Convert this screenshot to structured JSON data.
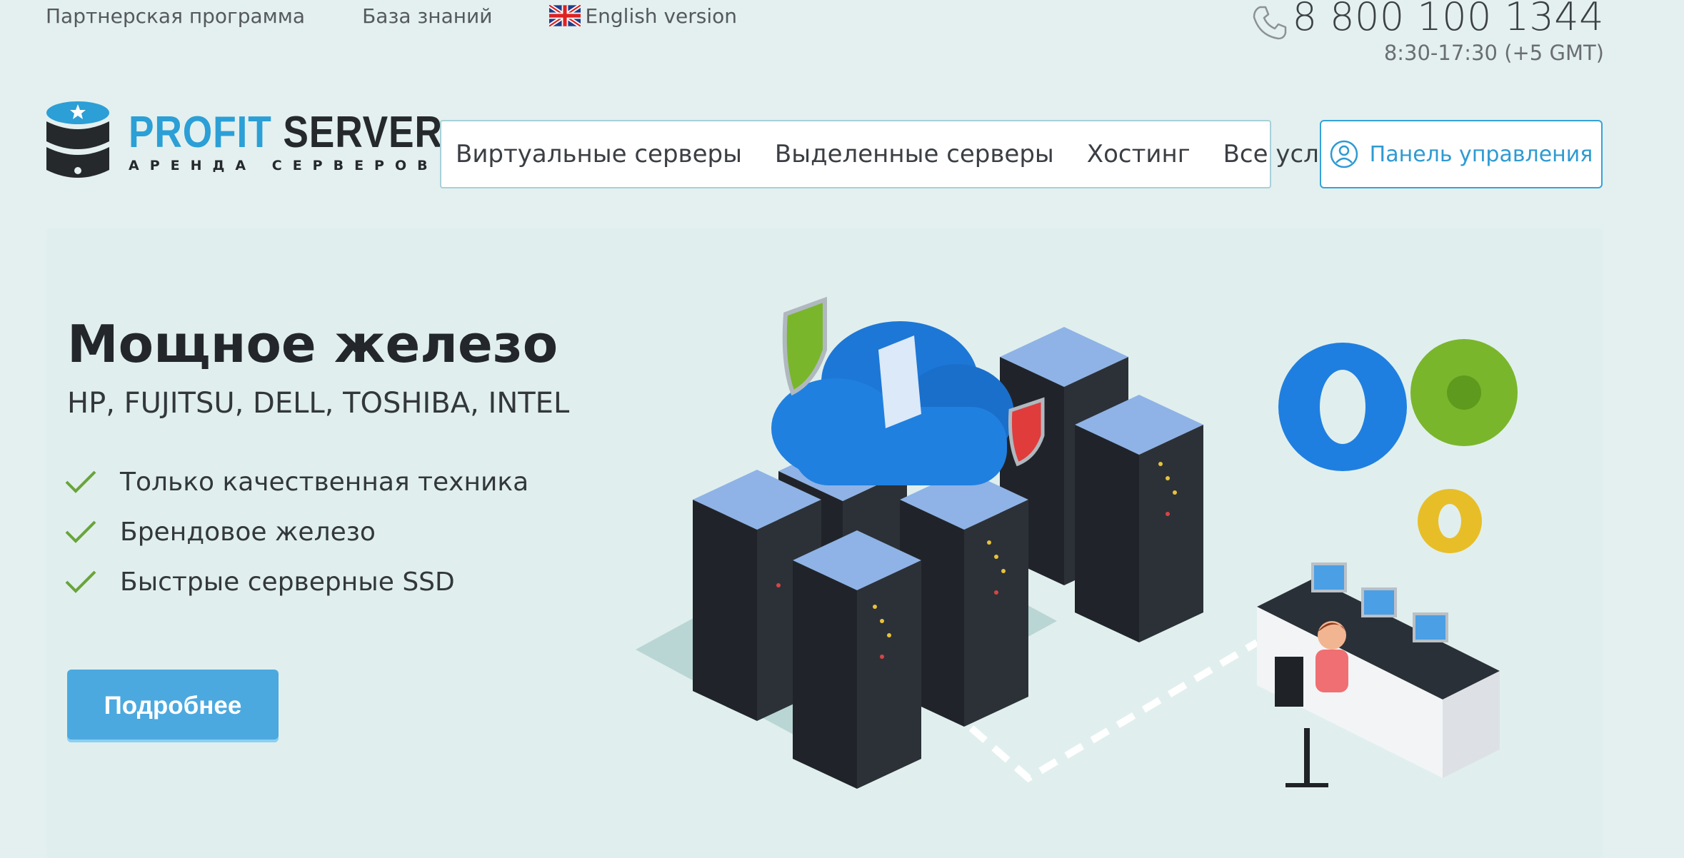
{
  "top_bar": {
    "links": [
      "Партнерская программа",
      "База знаний"
    ],
    "lang_link": "English version",
    "phone": "8 800 100 1344",
    "hours": "8:30-17:30 (+5 GMT)"
  },
  "logo": {
    "name_accent": "PROFIT",
    "name_dark": "SERVER",
    "tagline": "АРЕНДА СЕРВЕРОВ"
  },
  "nav": {
    "items": [
      "Виртуальные серверы",
      "Выделенные серверы",
      "Хостинг",
      "Все услуги"
    ]
  },
  "panel_button": "Панель управления",
  "hero": {
    "title": "Мощное железо",
    "subtitle": "HP, FUJITSU, DELL, TOSHIBA, INTEL",
    "features": [
      "Только качественная техника",
      "Брендовое железо",
      "Быстрые серверные SSD"
    ],
    "cta": "Подробнее"
  },
  "icons": {
    "phone": "phone-icon",
    "user": "user-icon",
    "check": "check-icon",
    "chevron": "chevron-down-icon",
    "flag": "uk-flag-icon"
  },
  "colors": {
    "background": "#e3f0ef",
    "accent": "#2b9fd6",
    "cta": "#4ca9df",
    "check": "#6aa43a"
  }
}
